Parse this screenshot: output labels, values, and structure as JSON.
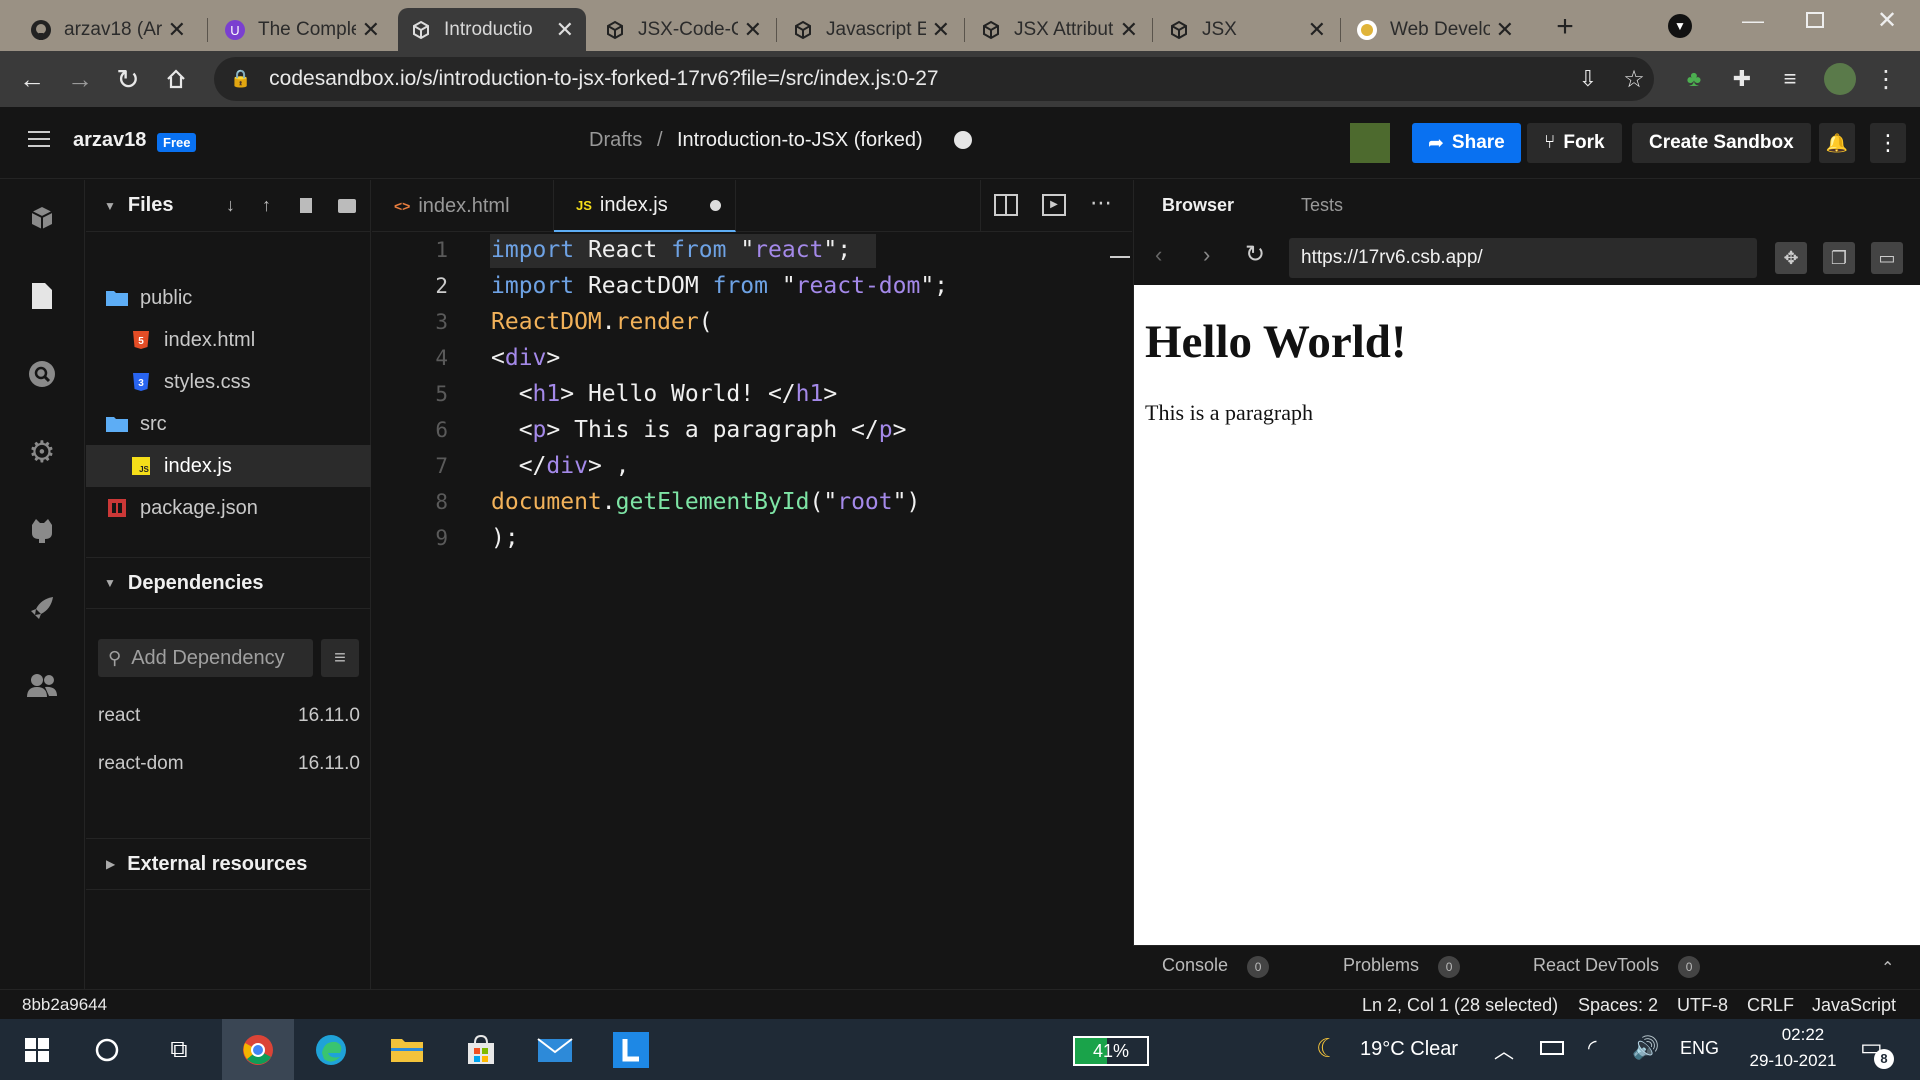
{
  "browser": {
    "tabs": [
      {
        "title": "arzav18 (Arz",
        "icon": "github-icon"
      },
      {
        "title": "The Comple",
        "icon": "course-icon"
      },
      {
        "title": "Introductio",
        "icon": "codesandbox-icon"
      },
      {
        "title": "JSX-Code-C",
        "icon": "codesandbox-icon"
      },
      {
        "title": "Javascript E",
        "icon": "codesandbox-icon"
      },
      {
        "title": "JSX Attribut",
        "icon": "codesandbox-icon"
      },
      {
        "title": "JSX",
        "icon": "codesandbox-icon"
      },
      {
        "title": "Web Develo",
        "icon": "coin-icon"
      }
    ],
    "active_tab": 2,
    "url": "codesandbox.io/s/introduction-to-jsx-forked-17rv6?file=/src/index.js:0-27"
  },
  "header": {
    "user": "arzav18",
    "badge": "Free",
    "breadcrumb_root": "Drafts",
    "separator": "/",
    "sandbox_title": "Introduction-to-JSX (forked)",
    "share": "Share",
    "fork": "Fork",
    "create": "Create Sandbox"
  },
  "sidebar": {
    "files_title": "Files",
    "files": [
      {
        "name": "public",
        "kind": "folder"
      },
      {
        "name": "index.html",
        "kind": "html"
      },
      {
        "name": "styles.css",
        "kind": "css"
      },
      {
        "name": "src",
        "kind": "folder"
      },
      {
        "name": "index.js",
        "kind": "js"
      },
      {
        "name": "package.json",
        "kind": "json"
      }
    ],
    "dependencies_title": "Dependencies",
    "add_dependency_placeholder": "Add Dependency",
    "dependencies": [
      {
        "name": "react",
        "version": "16.11.0"
      },
      {
        "name": "react-dom",
        "version": "16.11.0"
      }
    ],
    "external_title": "External resources"
  },
  "editor": {
    "tabs": [
      {
        "label": "index.html",
        "icon": "<>"
      },
      {
        "label": "index.js",
        "icon": "JS"
      }
    ],
    "line_numbers": [
      "1",
      "2",
      "3",
      "4",
      "5",
      "6",
      "7",
      "8",
      "9"
    ]
  },
  "preview": {
    "tab_browser": "Browser",
    "tab_tests": "Tests",
    "url": "https://17rv6.csb.app/",
    "h1": "Hello World!",
    "p": "This is a paragraph",
    "console": "Console",
    "console_count": "0",
    "problems": "Problems",
    "problems_count": "0",
    "devtools": "React DevTools",
    "devtools_count": "0"
  },
  "statusbar": {
    "hash": "8bb2a9644",
    "position": "Ln 2, Col 1 (28 selected)",
    "spaces": "Spaces: 2",
    "encoding": "UTF-8",
    "eol": "CRLF",
    "language": "JavaScript"
  },
  "taskbar": {
    "battery": "41%",
    "weather": "19°C  Clear",
    "lang": "ENG",
    "time": "02:22",
    "date": "29-10-2021",
    "notif_count": "8"
  }
}
